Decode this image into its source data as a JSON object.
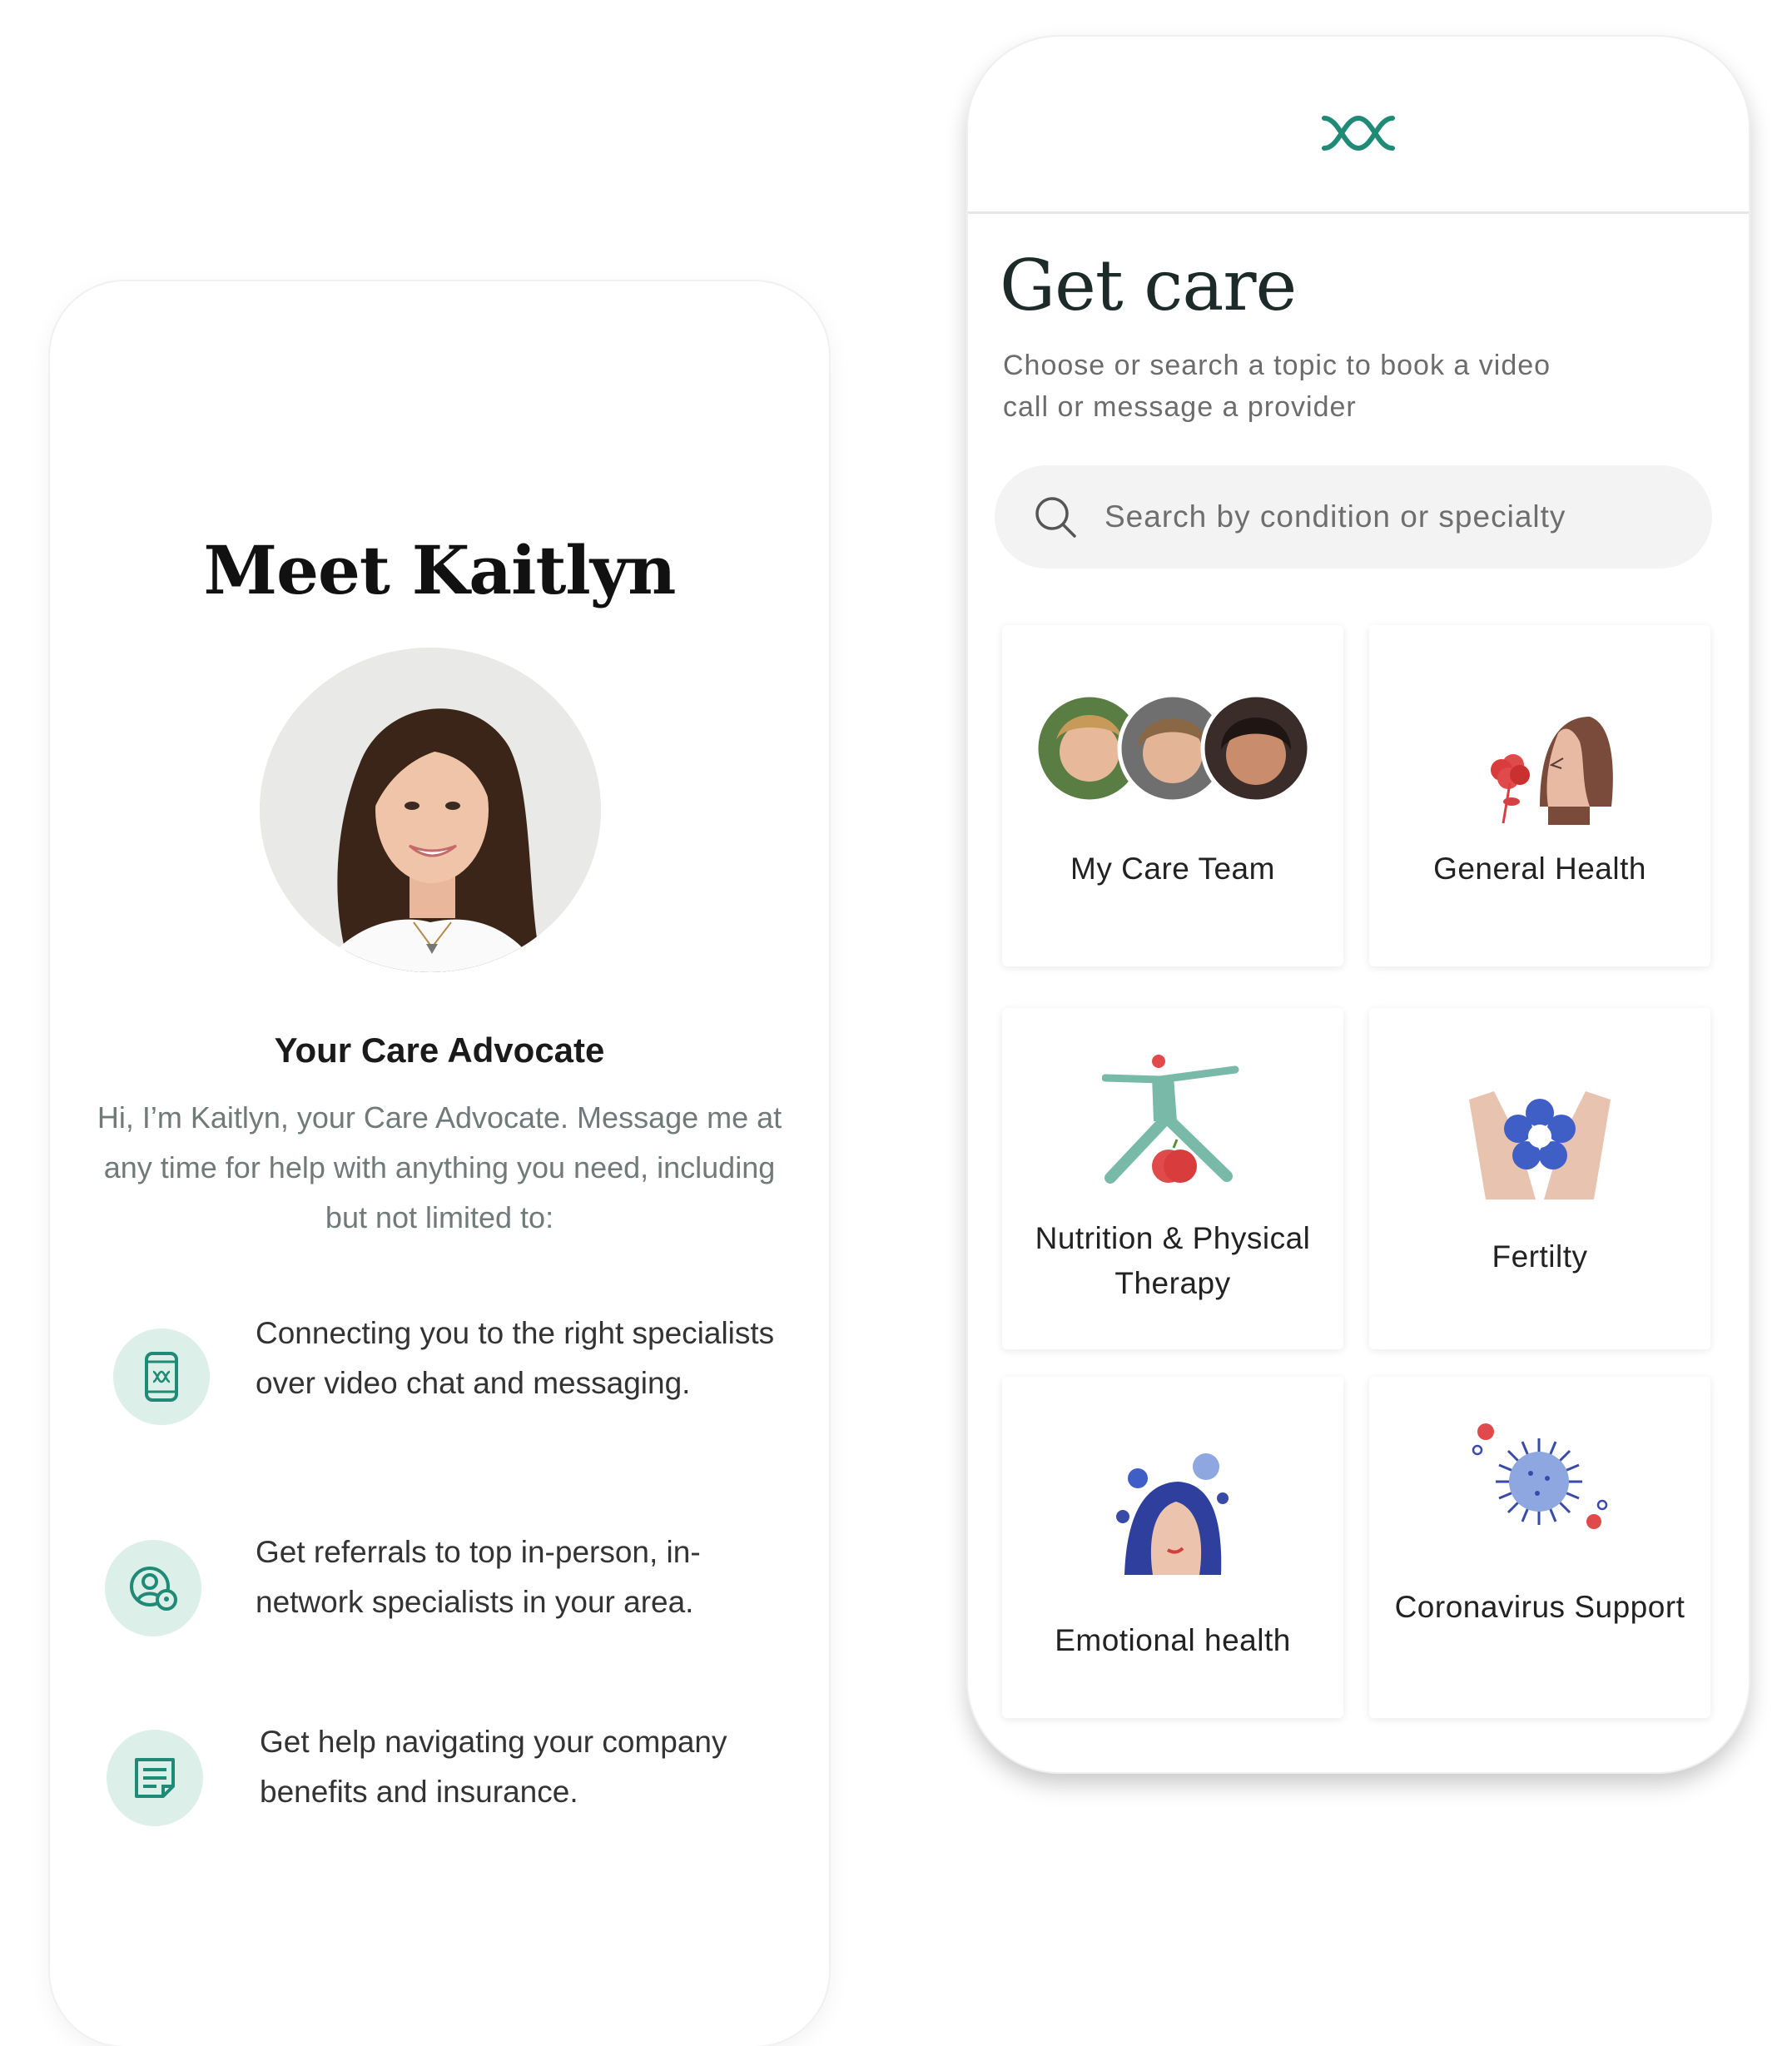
{
  "left_card": {
    "title": "Meet Kaitlyn",
    "role": "Your Care Advocate",
    "intro": "Hi, I’m Kaitlyn, your Care Advocate. Message me at any time for help with anything you need, including but not limited to:",
    "features": [
      {
        "icon": "phone-chat-icon",
        "text": "Connecting you to the right specialists over video chat and messaging."
      },
      {
        "icon": "referral-location-icon",
        "text": "Get referrals to top in-person, in-network specialists in your area."
      },
      {
        "icon": "document-icon",
        "text": "Get help navigating your company benefits and insurance."
      }
    ]
  },
  "right_card": {
    "logo": "brand-logo-icon",
    "title": "Get care",
    "subtitle": "Choose or search a topic to book a video call or message a provider",
    "search": {
      "placeholder": "Search by condition or specialty",
      "value": ""
    },
    "tiles": [
      {
        "label": "My Care Team"
      },
      {
        "label": "General Health"
      },
      {
        "label": "Nutrition & Physical Therapy"
      },
      {
        "label": "Fertilty"
      },
      {
        "label": "Emotional health"
      },
      {
        "label": "Coronavirus Support"
      }
    ]
  },
  "colors": {
    "brand_teal": "#1f8a75",
    "icon_bg": "#dcefe8",
    "text_muted": "#707a78"
  }
}
